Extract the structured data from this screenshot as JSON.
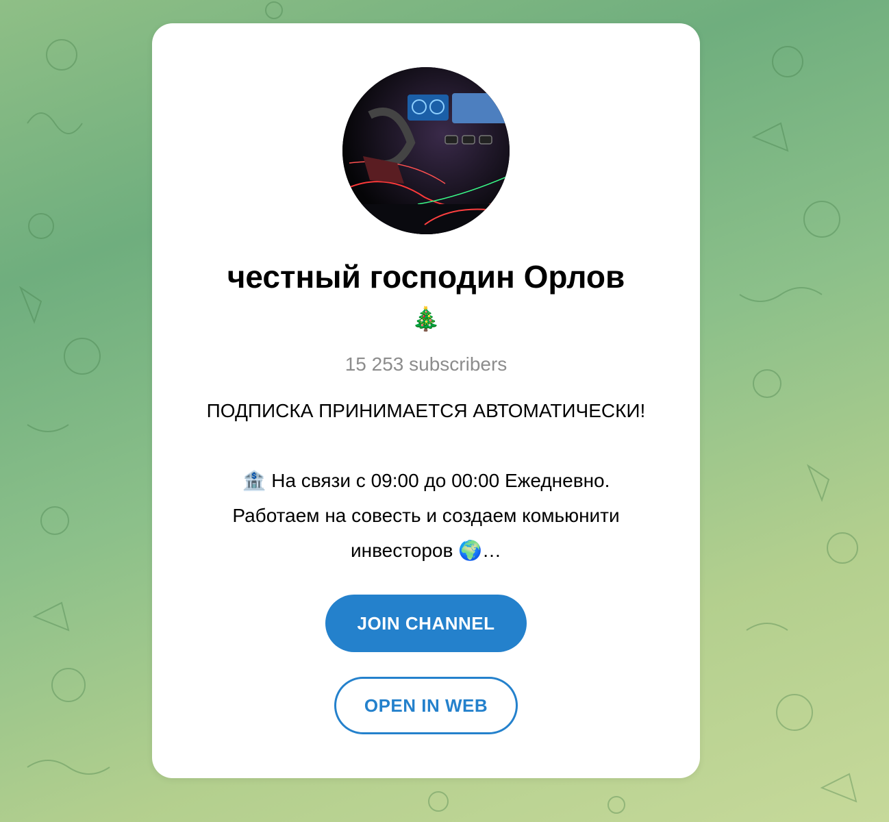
{
  "channel": {
    "title": "честный господин Орлов",
    "title_emoji": "🎄",
    "subscribers": "15 253 subscribers",
    "description": {
      "line1": "ПОДПИСКА ПРИНИМАЕТСЯ АВТОМАТИЧЕСКИ!",
      "line2": "🏦 На связи с 09:00 до 00:00 Ежедневно.",
      "line3": "Работаем на совесть и создаем комьюнити",
      "line4": "инвесторов 🌍…"
    }
  },
  "buttons": {
    "join": "JOIN CHANNEL",
    "open_web": "OPEN IN WEB"
  },
  "colors": {
    "accent": "#2481cc",
    "muted_text": "#8c8c8c",
    "background_green": "#8fbf86"
  },
  "icons": {
    "avatar": "car-interior-photo",
    "background": "doodle-pattern"
  }
}
